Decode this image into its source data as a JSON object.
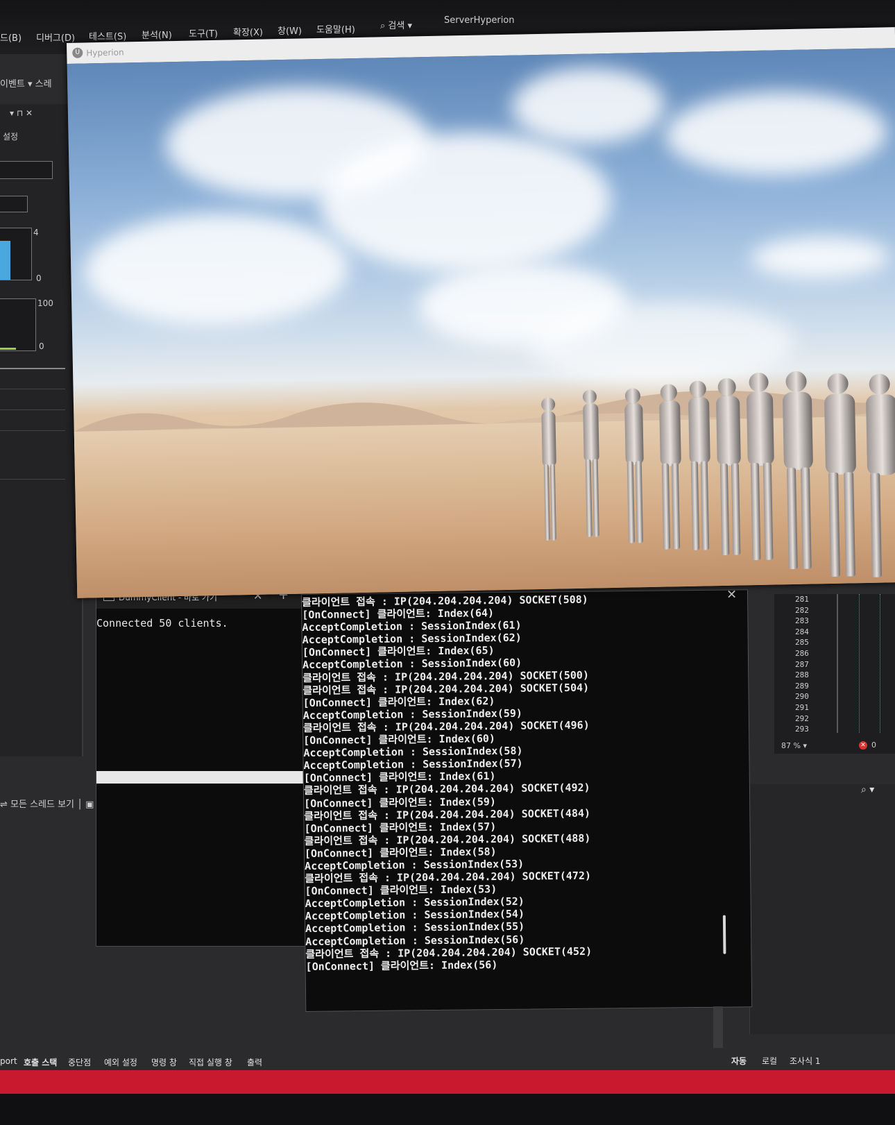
{
  "ide": {
    "menus": [
      "드(B)",
      "디버그(D)",
      "테스트(S)",
      "분석(N)",
      "도구(T)",
      "확장(X)",
      "창(W)",
      "도움말(H)"
    ],
    "search_label": "검색",
    "window_title": "ServerHyperion",
    "left_toolbar_label": "이벤트 ▾ 스레",
    "diag_panel_setting": "설정",
    "graph1_max": "4",
    "graph1_min": "0",
    "graph2_max": "100",
    "graph2_min": "0",
    "thread_toggle": "모든 스레드 보기",
    "bottom_tabs": [
      "port",
      "호출 스택",
      "중단점",
      "예외 설정",
      "명령 창",
      "직접 실행 창",
      "출력"
    ],
    "right_tabs": [
      "자동",
      "로컬",
      "조사식 1"
    ]
  },
  "game_window": {
    "title": "Hyperion"
  },
  "dummy_client": {
    "tab_label": "DummyClient - 바로 가기",
    "output": "Connected 50 clients."
  },
  "server_log": [
    "클라이언트 접속 : IP(204.204.204.204) SOCKET(508)",
    "[OnConnect] 클라이언트: Index(64)",
    "AcceptCompletion : SessionIndex(61)",
    "AcceptCompletion : SessionIndex(62)",
    "[OnConnect] 클라이언트: Index(65)",
    "AcceptCompletion : SessionIndex(60)",
    "클라이언트 접속 : IP(204.204.204.204) SOCKET(500)",
    "클라이언트 접속 : IP(204.204.204.204) SOCKET(504)",
    "[OnConnect] 클라이언트: Index(62)",
    "AcceptCompletion : SessionIndex(59)",
    "클라이언트 접속 : IP(204.204.204.204) SOCKET(496)",
    "[OnConnect] 클라이언트: Index(60)",
    "AcceptCompletion : SessionIndex(58)",
    "AcceptCompletion : SessionIndex(57)",
    "[OnConnect] 클라이언트: Index(61)",
    "클라이언트 접속 : IP(204.204.204.204) SOCKET(492)",
    "[OnConnect] 클라이언트: Index(59)",
    "클라이언트 접속 : IP(204.204.204.204) SOCKET(484)",
    "[OnConnect] 클라이언트: Index(57)",
    "클라이언트 접속 : IP(204.204.204.204) SOCKET(488)",
    "[OnConnect] 클라이언트: Index(58)",
    "AcceptCompletion : SessionIndex(53)",
    "클라이언트 접속 : IP(204.204.204.204) SOCKET(472)",
    "[OnConnect] 클라이언트: Index(53)",
    "AcceptCompletion : SessionIndex(52)",
    "AcceptCompletion : SessionIndex(54)",
    "AcceptCompletion : SessionIndex(55)",
    "AcceptCompletion : SessionIndex(56)",
    "클라이언트 접속 : IP(204.204.204.204) SOCKET(452)",
    "[OnConnect] 클라이언트: Index(56)"
  ],
  "code_panel": {
    "line_numbers": [
      "281",
      "282",
      "283",
      "284",
      "285",
      "286",
      "287",
      "288",
      "289",
      "290",
      "291",
      "292",
      "293"
    ],
    "zoom": "87 %",
    "error_count": "0"
  },
  "colors": {
    "status_bar": "#c8192f",
    "console_bg": "#0c0c0c",
    "ide_bg": "#2b2b2e"
  }
}
